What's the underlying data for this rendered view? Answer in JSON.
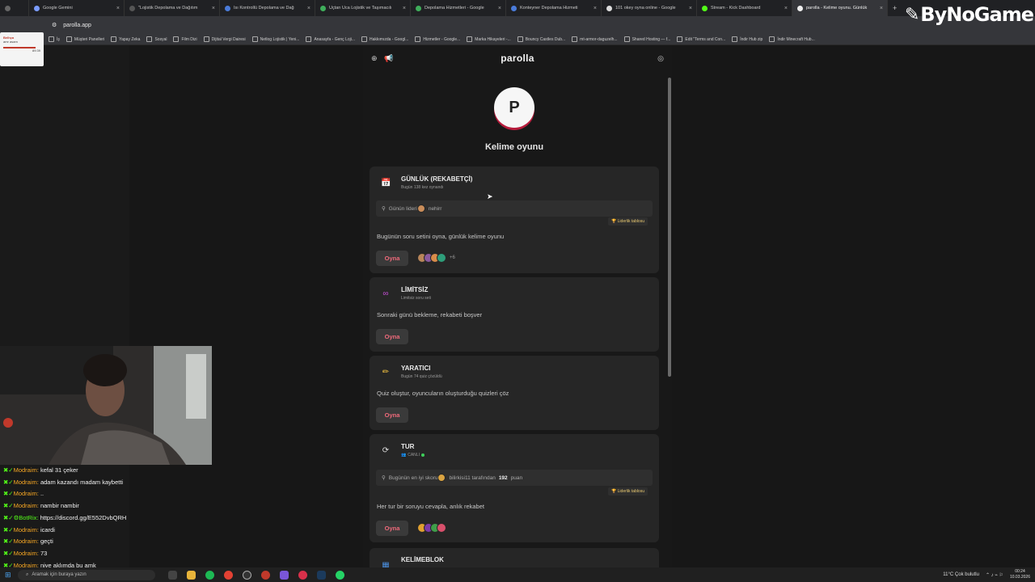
{
  "browser": {
    "tabs": [
      {
        "label": "Google Gemini",
        "active": false
      },
      {
        "label": "\"Lojistik Depolama ve Dağıtım",
        "active": false
      },
      {
        "label": "Isı Kontrollü Depolama ve Dağ",
        "active": false
      },
      {
        "label": "Uçtan Uca Lojistik ve Taşımacılı",
        "active": false
      },
      {
        "label": "Depolama Hizmetleri - Google",
        "active": false
      },
      {
        "label": "Konteyner Depolama Hizmeti",
        "active": false
      },
      {
        "label": "101 okey oyna online - Google",
        "active": false
      },
      {
        "label": "Stream - Kick Dashboard",
        "active": false
      },
      {
        "label": "parolla - Kelime oyunu. Günlük",
        "active": true
      }
    ],
    "url": "parolla.app",
    "bookmarks": [
      "İş",
      "Müşteri Panelleri",
      "Yapay Zeka",
      "Sosyal",
      "Film Dizi",
      "Dijital Vergi Dairesi",
      "Netlog Lojistik | Yeni...",
      "Anasayfa - Genç Loji...",
      "Hakkımızda - Googl...",
      "Hizmetler - Google...",
      "Marka Hikayeleri -...",
      "Bouncy Castles Dub...",
      "mt-armor-daguzelh...",
      "Shared Hosting — f...",
      "Edit \"Terms and Con...",
      "İndir Hub zip",
      "İndir Minecraft Hub..."
    ],
    "brand_logo": "ByNoGame"
  },
  "mini_window": {
    "title": "Belhça",
    "line": "amr asam",
    "value": "89:39"
  },
  "app": {
    "title": "parolla",
    "avatar_letter": "P",
    "subtitle": "Kelime oyunu",
    "cards": [
      {
        "icon": "calendar-icon",
        "title": "GÜNLÜK (REKABETÇİ)",
        "sub": "Bugün 138 kez oynandı",
        "strip_label": "Günün lideri",
        "strip_name": "nehirr",
        "leaderboard": "Liderlik tablosu",
        "desc": "Bugünün soru setini oyna, günlük kelime oyunu",
        "play": "Oyna",
        "more": "+6"
      },
      {
        "icon": "infinity-icon",
        "title": "LİMİTSİZ",
        "sub": "Limitsiz soru seti",
        "desc": "Sonraki günü bekleme, rekabeti boşver",
        "play": "Oyna"
      },
      {
        "icon": "pencil-icon",
        "title": "YARATICI",
        "sub": "Bugün 74 quiz çözüldü",
        "desc": "Quiz oluştur, oyuncuların oluşturduğu quizleri çöz",
        "play": "Oyna"
      },
      {
        "icon": "refresh-icon",
        "title": "TUR",
        "sub": "CANLI",
        "strip_label": "Bugünün en iyi skoru",
        "strip_name": "bilirkisi11 tarafından",
        "strip_score": "192",
        "strip_unit": "puan",
        "leaderboard": "Liderlik tablosu",
        "desc": "Her tur bir soruyu cevapla, anlık rekabet",
        "play": "Oyna"
      },
      {
        "icon": "grid-icon",
        "title": "KELİMEBLOK"
      }
    ]
  },
  "chat": [
    {
      "user": "Modraim:",
      "text": "kefal 31 çeker",
      "bot": false
    },
    {
      "user": "Modraim:",
      "text": "adam kazandı madam kaybetti",
      "bot": false
    },
    {
      "user": "Modraim:",
      "text": "..",
      "bot": false
    },
    {
      "user": "Modraim:",
      "text": "nambir nambir",
      "bot": false
    },
    {
      "user": "BotRix:",
      "text": "https://discord.gg/E552DvbQRH",
      "bot": true
    },
    {
      "user": "Modraim:",
      "text": "icardi",
      "bot": false
    },
    {
      "user": "Modraim:",
      "text": "geçti",
      "bot": false
    },
    {
      "user": "Modraim:",
      "text": "73",
      "bot": false
    },
    {
      "user": "Modraim:",
      "text": "niye aklımda bu amk",
      "bot": false
    }
  ],
  "taskbar": {
    "search_placeholder": "Aramak için buraya yazın",
    "weather": "11°C  Çok bulutlu",
    "time": "00:24",
    "date": "10.03.2026"
  },
  "colors": {
    "accent": "#f06a7b",
    "brand_shadow": "#b71c3c",
    "live": "#3ecf5a",
    "chat_user": "#f5a623",
    "chat_bot": "#53fc18"
  }
}
